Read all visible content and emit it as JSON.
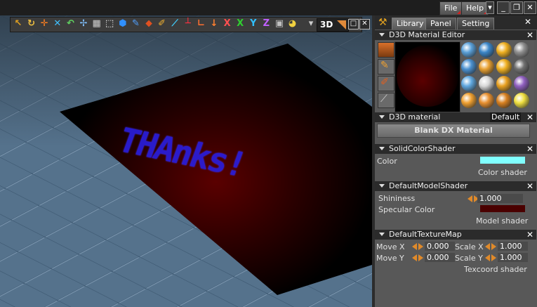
{
  "menubar": {
    "file_label": "File",
    "help_label": "Help",
    "minimize_glyph": "_",
    "restore_glyph": "❐",
    "close_glyph": "✕",
    "dropdown_glyph": "▾"
  },
  "viewport": {
    "mode_label": "3D",
    "canvas_text": "THAnks!",
    "floor_color": "#4f6b85",
    "plane_color": "#000000",
    "glow_color": "#5a0000",
    "text_color": "#2a1ee0",
    "toolbar_tools": [
      {
        "icon": "grab-icon",
        "glyph": "↖",
        "color": "#e0a020"
      },
      {
        "icon": "rotate-icon",
        "glyph": "↻",
        "color": "#f0c040"
      },
      {
        "icon": "move-icon",
        "glyph": "✛",
        "color": "#ff8020"
      },
      {
        "icon": "scale-icon",
        "glyph": "✕",
        "color": "#40c0ff"
      },
      {
        "icon": "undo-icon",
        "glyph": "↶",
        "color": "#60d060"
      },
      {
        "icon": "transform-icon",
        "glyph": "✢",
        "color": "#80c0ff"
      },
      {
        "icon": "checker-icon",
        "glyph": "▦",
        "color": "#d0d0d0"
      },
      {
        "icon": "select-icon",
        "glyph": "⬚",
        "color": "#ffffff"
      },
      {
        "icon": "object-icon",
        "glyph": "⬢",
        "color": "#3090ff"
      },
      {
        "icon": "paint-icon",
        "glyph": "✎",
        "color": "#50a0ff"
      },
      {
        "icon": "brush-icon",
        "glyph": "⬥",
        "color": "#e05020"
      },
      {
        "icon": "pencil-icon",
        "glyph": "✐",
        "color": "#f0b030"
      },
      {
        "icon": "eyedrop-icon",
        "glyph": "⟋",
        "color": "#40d0ff"
      },
      {
        "icon": "axis-icon",
        "glyph": "┴",
        "color": "#ff3040"
      },
      {
        "icon": "corner-icon",
        "glyph": "∟",
        "color": "#ff7030"
      },
      {
        "icon": "down-arrow-icon",
        "glyph": "↓",
        "color": "#ff8030"
      },
      {
        "icon": "axis-x-icon",
        "glyph": "X",
        "color": "#ff5050"
      },
      {
        "icon": "axis-x2-icon",
        "glyph": "X",
        "color": "#30d030"
      },
      {
        "icon": "axis-y-icon",
        "glyph": "Y",
        "color": "#30c0ff"
      },
      {
        "icon": "axis-z-icon",
        "glyph": "Z",
        "color": "#c060ff"
      },
      {
        "icon": "grid-icon",
        "glyph": "▣",
        "color": "#c0c0c0"
      },
      {
        "icon": "palette-icon",
        "glyph": "◕",
        "color": "#f0d040"
      }
    ]
  },
  "panel": {
    "tabs": [
      "Library",
      "Panel",
      "Setting"
    ],
    "close_glyph": "✕",
    "material_editor": {
      "title": "D3D Material Editor"
    },
    "d3d_material": {
      "title": "D3D material",
      "default_label": "Default",
      "name": "Blank DX Material"
    },
    "solid_color": {
      "title": "SolidColorShader",
      "color_label": "Color",
      "swatch_color": "#80ffff",
      "footer": "Color  shader"
    },
    "model_shader": {
      "title": "DefaultModelShader",
      "shininess_label": "Shininess",
      "shininess_value": "1.000",
      "specular_label": "Specular  Color",
      "specular_color": "#4a0000",
      "footer": "Model  shader"
    },
    "texture_map": {
      "title": "DefaultTextureMap",
      "move_x_label": "Move  X",
      "move_x_value": "0.000",
      "scale_x_label": "Scale  X",
      "scale_x_value": "1.000",
      "move_y_label": "Move  Y",
      "move_y_value": "0.000",
      "scale_y_label": "Scale  Y",
      "scale_y_value": "1.000",
      "footer": "Texcoord  shader"
    }
  }
}
